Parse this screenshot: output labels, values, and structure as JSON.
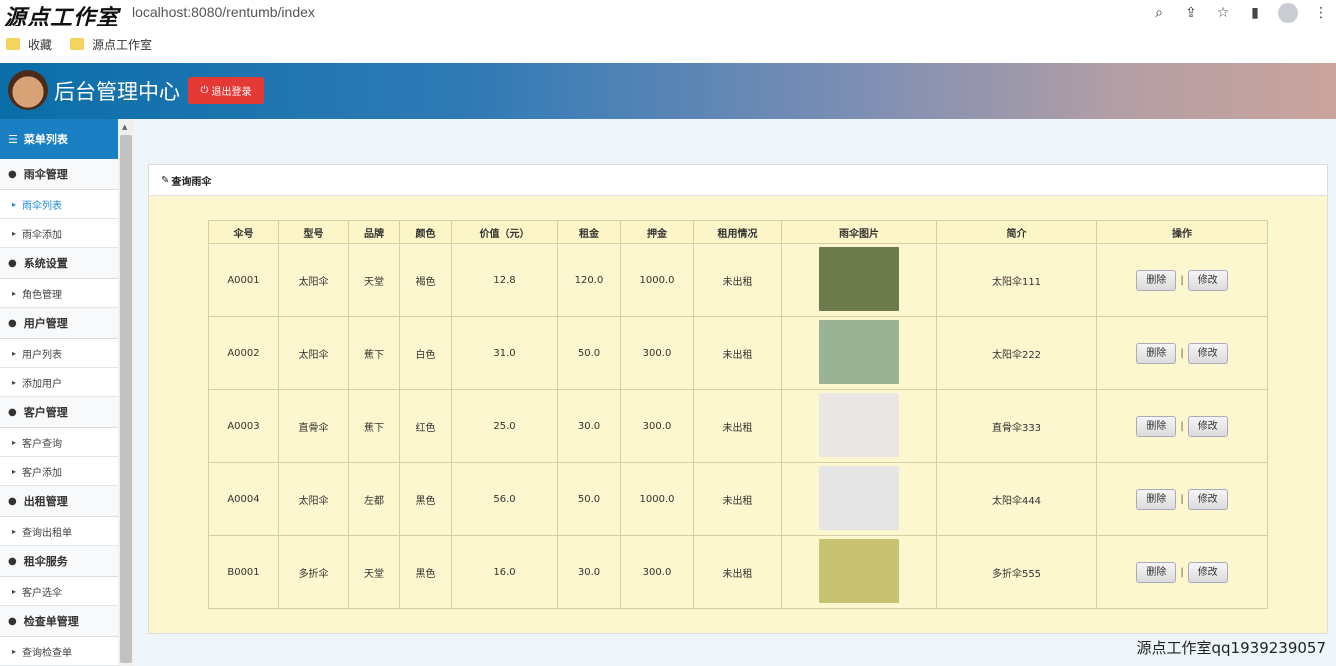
{
  "browser": {
    "watermark": "源点工作室",
    "url": "localhost:8080/rentumb/index",
    "bookmarks": [
      "收藏",
      "源点工作室"
    ]
  },
  "header": {
    "title": "后台管理中心",
    "logout_label": "退出登录"
  },
  "sidebar": {
    "menu_title": "菜单列表",
    "groups": [
      {
        "label": "雨伞管理",
        "items": [
          "雨伞列表",
          "雨伞添加"
        ]
      },
      {
        "label": "系统设置",
        "items": [
          "角色管理"
        ]
      },
      {
        "label": "用户管理",
        "items": [
          "用户列表",
          "添加用户"
        ]
      },
      {
        "label": "客户管理",
        "items": [
          "客户查询",
          "客户添加"
        ]
      },
      {
        "label": "出租管理",
        "items": [
          "查询出租单"
        ]
      },
      {
        "label": "租伞服务",
        "items": [
          "客户选伞"
        ]
      },
      {
        "label": "检查单管理",
        "items": [
          "查询检查单"
        ]
      }
    ]
  },
  "panel": {
    "title": "查询雨伞"
  },
  "table": {
    "columns": [
      "伞号",
      "型号",
      "品牌",
      "颜色",
      "价值（元）",
      "租金",
      "押金",
      "租用情况",
      "雨伞图片",
      "简介",
      "操作"
    ],
    "delete_label": "删除",
    "edit_label": "修改",
    "separator": "|",
    "rows": [
      {
        "id": "A0001",
        "model": "太阳伞",
        "brand": "天堂",
        "color": "褐色",
        "value": "12.8",
        "rent": "120.0",
        "deposit": "1000.0",
        "status": "未出租",
        "intro": "太阳伞111",
        "img_bg": "#6c7a4c"
      },
      {
        "id": "A0002",
        "model": "太阳伞",
        "brand": "蕉下",
        "color": "白色",
        "value": "31.0",
        "rent": "50.0",
        "deposit": "300.0",
        "status": "未出租",
        "intro": "太阳伞222",
        "img_bg": "#9ab394"
      },
      {
        "id": "A0003",
        "model": "直骨伞",
        "brand": "蕉下",
        "color": "红色",
        "value": "25.0",
        "rent": "30.0",
        "deposit": "300.0",
        "status": "未出租",
        "intro": "直骨伞333",
        "img_bg": "#e9e6e4"
      },
      {
        "id": "A0004",
        "model": "太阳伞",
        "brand": "左都",
        "color": "黑色",
        "value": "56.0",
        "rent": "50.0",
        "deposit": "1000.0",
        "status": "未出租",
        "intro": "太阳伞444",
        "img_bg": "#e5e5e5"
      },
      {
        "id": "B0001",
        "model": "多折伞",
        "brand": "天堂",
        "color": "黑色",
        "value": "16.0",
        "rent": "30.0",
        "deposit": "300.0",
        "status": "未出租",
        "intro": "多折伞555",
        "img_bg": "#c8c273"
      }
    ]
  },
  "footer_watermark": "源点工作室qq1939239057"
}
